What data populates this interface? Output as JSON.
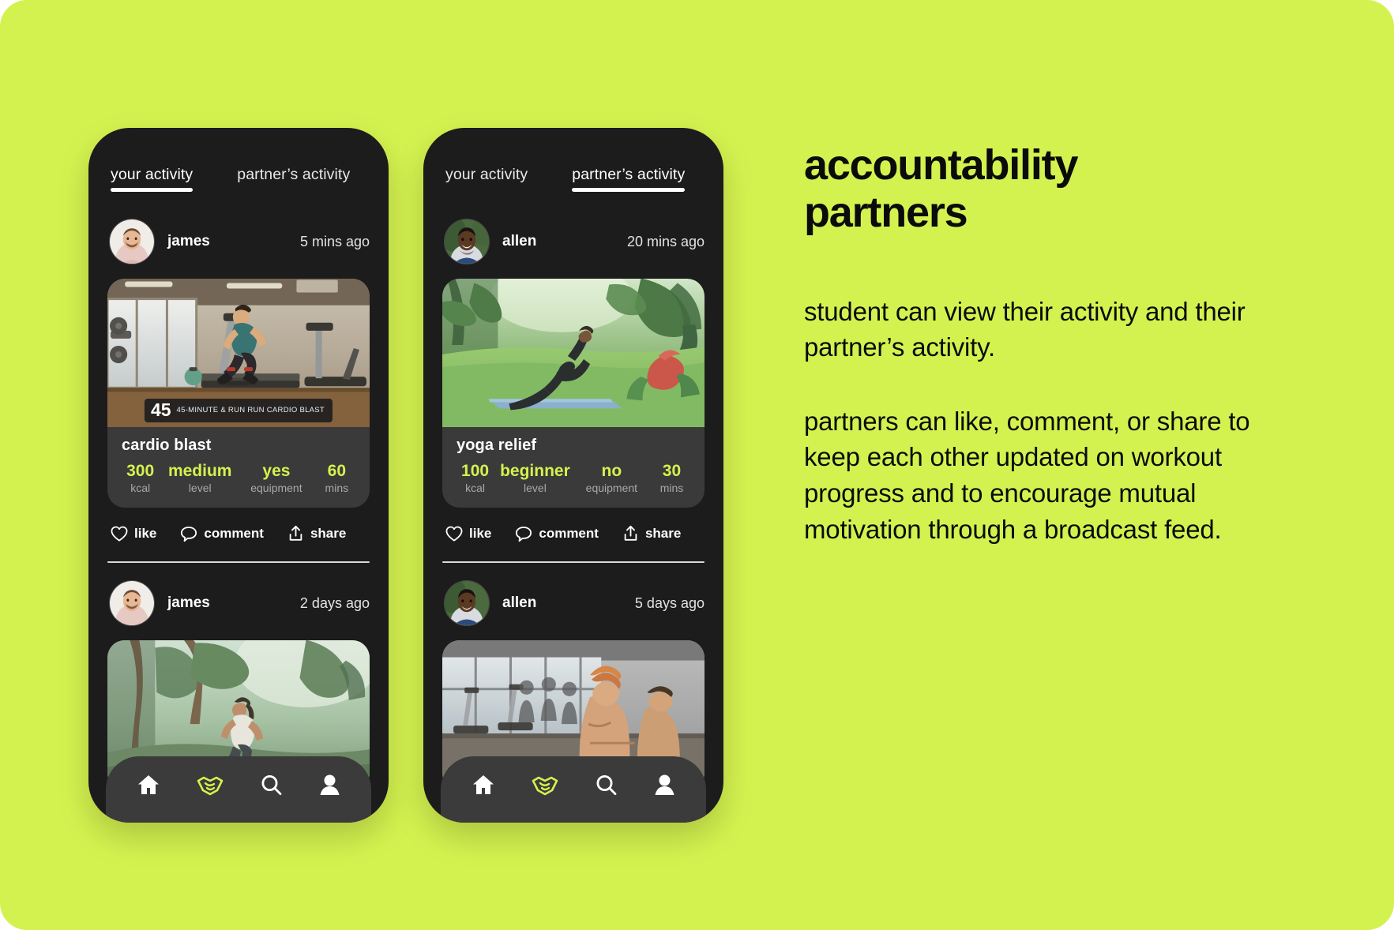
{
  "theme": {
    "background": "#d4f24f",
    "phone_bg": "#1c1c1c",
    "card_bg": "#3a3a3a",
    "accent": "#d4f24f",
    "text_primary": "#ffffff",
    "text_muted": "#a9a9a9",
    "panel_text": "#0b0b0b"
  },
  "panel": {
    "title": "accountability partners",
    "paragraph_1": "student can view their activity and their partner’s activity.",
    "paragraph_2": "partners can like, comment, or share to keep each other updated on workout progress and to encourage mutual motivation through a broadcast feed."
  },
  "phones": [
    {
      "name": "your-activity-screen",
      "tabs": [
        {
          "label": "your activity",
          "active": true
        },
        {
          "label": "partner’s activity",
          "active": false
        }
      ],
      "posts": [
        {
          "user": "james",
          "avatar": "man-light-skin-avatar",
          "time": "5 mins ago",
          "media": "treadmill-gym-running-photo",
          "media_badge_number": "45",
          "media_badge_text": "45-MINUTE & RUN RUN CARDIO BLAST",
          "title": "cardio blast",
          "stats": [
            {
              "value": "300",
              "label": "kcal"
            },
            {
              "value": "medium",
              "label": "level"
            },
            {
              "value": "yes",
              "label": "equipment"
            },
            {
              "value": "60",
              "label": "mins"
            }
          ],
          "actions": [
            {
              "icon": "heart-icon",
              "label": "like"
            },
            {
              "icon": "comment-bubble-icon",
              "label": "comment"
            },
            {
              "icon": "share-icon",
              "label": "share"
            }
          ]
        },
        {
          "user": "james",
          "avatar": "man-light-skin-avatar",
          "time": "2 days ago",
          "media": "woman-running-forest-trail-photo"
        }
      ],
      "nav": [
        {
          "icon": "home-icon",
          "active": false
        },
        {
          "icon": "handshake-icon",
          "active": true
        },
        {
          "icon": "search-icon",
          "active": false
        },
        {
          "icon": "person-icon",
          "active": false
        }
      ]
    },
    {
      "name": "partners-activity-screen",
      "tabs": [
        {
          "label": "your activity",
          "active": false
        },
        {
          "label": "partner’s activity",
          "active": true
        }
      ],
      "posts": [
        {
          "user": "allen",
          "avatar": "man-dark-skin-avatar",
          "time": "20 mins ago",
          "media": "yoga-pose-green-jungle-lawn-photo",
          "media_badge_number": "",
          "media_badge_text": "",
          "title": "yoga relief",
          "stats": [
            {
              "value": "100",
              "label": "kcal"
            },
            {
              "value": "beginner",
              "label": "level"
            },
            {
              "value": "no",
              "label": "equipment"
            },
            {
              "value": "30",
              "label": "mins"
            }
          ],
          "actions": [
            {
              "icon": "heart-icon",
              "label": "like"
            },
            {
              "icon": "comment-bubble-icon",
              "label": "comment"
            },
            {
              "icon": "share-icon",
              "label": "share"
            }
          ]
        },
        {
          "user": "allen",
          "avatar": "man-dark-skin-avatar",
          "time": "5 days ago",
          "media": "gym-treadmill-crowd-photo"
        }
      ],
      "nav": [
        {
          "icon": "home-icon",
          "active": false
        },
        {
          "icon": "handshake-icon",
          "active": true
        },
        {
          "icon": "search-icon",
          "active": false
        },
        {
          "icon": "person-icon",
          "active": false
        }
      ]
    }
  ]
}
